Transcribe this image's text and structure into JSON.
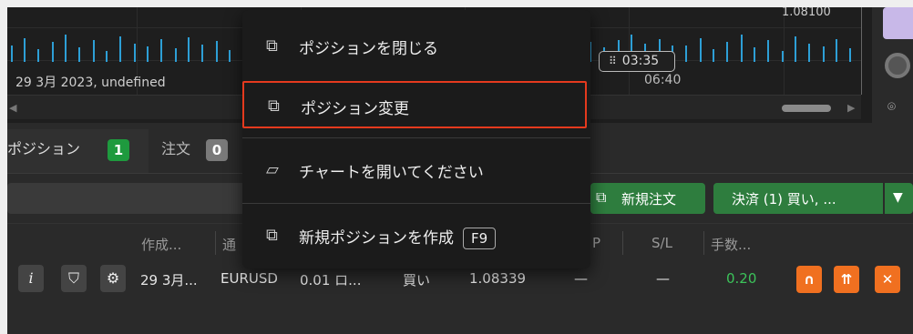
{
  "chart": {
    "date_label": "29 3月 2023, undefined",
    "price_tag": "1.08100",
    "time_label": "06:40",
    "countdown": "03:35"
  },
  "context_menu": {
    "items": [
      {
        "label": "ポジションを閉じる",
        "icon": "close-position-icon"
      },
      {
        "label": "ポジション変更",
        "icon": "modify-position-icon",
        "highlighted": true
      },
      {
        "label": "チャートを開いてください",
        "icon": "chart-icon"
      },
      {
        "label": "新規ポジションを作成",
        "icon": "new-position-icon",
        "shortcut": "F9"
      }
    ]
  },
  "tabs": [
    {
      "label": "ポジション",
      "count": "1"
    },
    {
      "label": "注文",
      "count": "0"
    }
  ],
  "toolbar": {
    "new_order_label": "新規注文",
    "close_label": "決済 (1) 買い, ...",
    "dropdown_label": "▼"
  },
  "table": {
    "headers": {
      "created": "作成...",
      "symbol": "通",
      "tp": "P",
      "sl": "S/L",
      "fee": "手数..."
    },
    "row": {
      "created": "29 3月...",
      "symbol": "EURUSD",
      "amount": "0.01 ロ...",
      "side": "買い",
      "price": "1.08339",
      "tp": "—",
      "sl": "—",
      "fee": "0.20"
    }
  },
  "colors": {
    "accent_green": "#1e9a3e",
    "highlight_red": "#e53a1e",
    "action_orange": "#f07020",
    "bar_blue": "#2d9fd6"
  }
}
